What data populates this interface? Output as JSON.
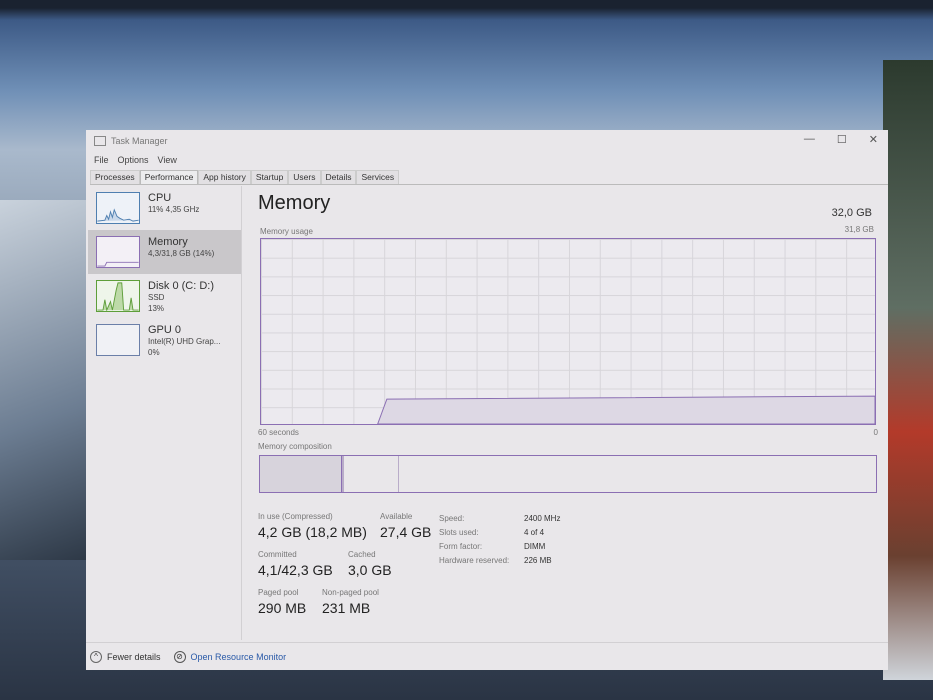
{
  "window": {
    "title": "Task Manager",
    "controls": [
      "—",
      "☐",
      "✕"
    ]
  },
  "menu": [
    "File",
    "Options",
    "View"
  ],
  "tabs": [
    "Processes",
    "Performance",
    "App history",
    "Startup",
    "Users",
    "Details",
    "Services"
  ],
  "sidebar": [
    {
      "name": "CPU",
      "sub1": "11% 4,35 GHz",
      "sub2": ""
    },
    {
      "name": "Memory",
      "sub1": "4,3/31,8 GB (14%)",
      "sub2": ""
    },
    {
      "name": "Disk 0 (C: D:)",
      "sub1": "SSD",
      "sub2": "13%"
    },
    {
      "name": "GPU 0",
      "sub1": "Intel(R) UHD Grap...",
      "sub2": "0%"
    }
  ],
  "main": {
    "title": "Memory",
    "total": "32,0 GB",
    "usage_label": "Memory usage",
    "usage_max": "31,8 GB",
    "time_left": "60 seconds",
    "time_right": "0",
    "composition_label": "Memory composition",
    "usage_fraction": 0.14,
    "colors": {
      "accent": "#8b6fb3"
    }
  },
  "stats": {
    "in_use_label": "In use (Compressed)",
    "in_use": "4,2 GB (18,2 MB)",
    "available_label": "Available",
    "available": "27,4 GB",
    "committed_label": "Committed",
    "committed": "4,1/42,3 GB",
    "cached_label": "Cached",
    "cached": "3,0 GB",
    "paged_label": "Paged pool",
    "paged": "290 MB",
    "nonpaged_label": "Non-paged pool",
    "nonpaged": "231 MB",
    "speed_label": "Speed:",
    "speed": "2400 MHz",
    "slots_label": "Slots used:",
    "slots": "4 of 4",
    "form_label": "Form factor:",
    "form": "DIMM",
    "hwres_label": "Hardware reserved:",
    "hwres": "226 MB"
  },
  "footer": {
    "fewer": "Fewer details",
    "monitor": "Open Resource Monitor"
  }
}
